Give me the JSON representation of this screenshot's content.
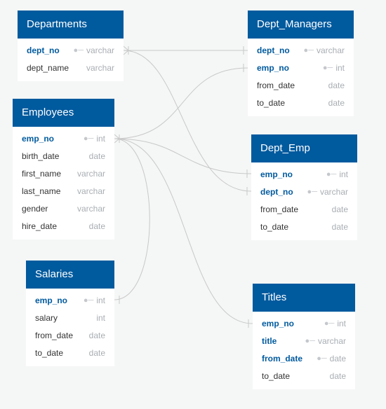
{
  "tables": [
    {
      "name": "Departments",
      "columns": [
        {
          "name": "dept_no",
          "type": "varchar",
          "pk": true
        },
        {
          "name": "dept_name",
          "type": "varchar",
          "pk": false
        }
      ]
    },
    {
      "name": "Dept_Managers",
      "columns": [
        {
          "name": "dept_no",
          "type": "varchar",
          "pk": true
        },
        {
          "name": "emp_no",
          "type": "int",
          "pk": true
        },
        {
          "name": "from_date",
          "type": "date",
          "pk": false
        },
        {
          "name": "to_date",
          "type": "date",
          "pk": false
        }
      ]
    },
    {
      "name": "Employees",
      "columns": [
        {
          "name": "emp_no",
          "type": "int",
          "pk": true
        },
        {
          "name": "birth_date",
          "type": "date",
          "pk": false
        },
        {
          "name": "first_name",
          "type": "varchar",
          "pk": false
        },
        {
          "name": "last_name",
          "type": "varchar",
          "pk": false
        },
        {
          "name": "gender",
          "type": "varchar",
          "pk": false
        },
        {
          "name": "hire_date",
          "type": "date",
          "pk": false
        }
      ]
    },
    {
      "name": "Dept_Emp",
      "columns": [
        {
          "name": "emp_no",
          "type": "int",
          "pk": true
        },
        {
          "name": "dept_no",
          "type": "varchar",
          "pk": true
        },
        {
          "name": "from_date",
          "type": "date",
          "pk": false
        },
        {
          "name": "to_date",
          "type": "date",
          "pk": false
        }
      ]
    },
    {
      "name": "Salaries",
      "columns": [
        {
          "name": "emp_no",
          "type": "int",
          "pk": true
        },
        {
          "name": "salary",
          "type": "int",
          "pk": false
        },
        {
          "name": "from_date",
          "type": "date",
          "pk": false
        },
        {
          "name": "to_date",
          "type": "date",
          "pk": false
        }
      ]
    },
    {
      "name": "Titles",
      "columns": [
        {
          "name": "emp_no",
          "type": "int",
          "pk": true
        },
        {
          "name": "title",
          "type": "varchar",
          "pk": true
        },
        {
          "name": "from_date",
          "type": "date",
          "pk": true
        },
        {
          "name": "to_date",
          "type": "date",
          "pk": false
        }
      ]
    }
  ],
  "relationships": [
    {
      "from": "Departments.dept_no",
      "to": "Dept_Managers.dept_no"
    },
    {
      "from": "Departments.dept_no",
      "to": "Dept_Emp.dept_no"
    },
    {
      "from": "Employees.emp_no",
      "to": "Dept_Managers.emp_no"
    },
    {
      "from": "Employees.emp_no",
      "to": "Dept_Emp.emp_no"
    },
    {
      "from": "Employees.emp_no",
      "to": "Salaries.emp_no"
    },
    {
      "from": "Employees.emp_no",
      "to": "Titles.emp_no"
    }
  ],
  "colors": {
    "header": "#005a9e",
    "pk_text": "#005a9e",
    "link": "#c8c8c8"
  },
  "icons": {
    "primary_key": "key-icon"
  }
}
